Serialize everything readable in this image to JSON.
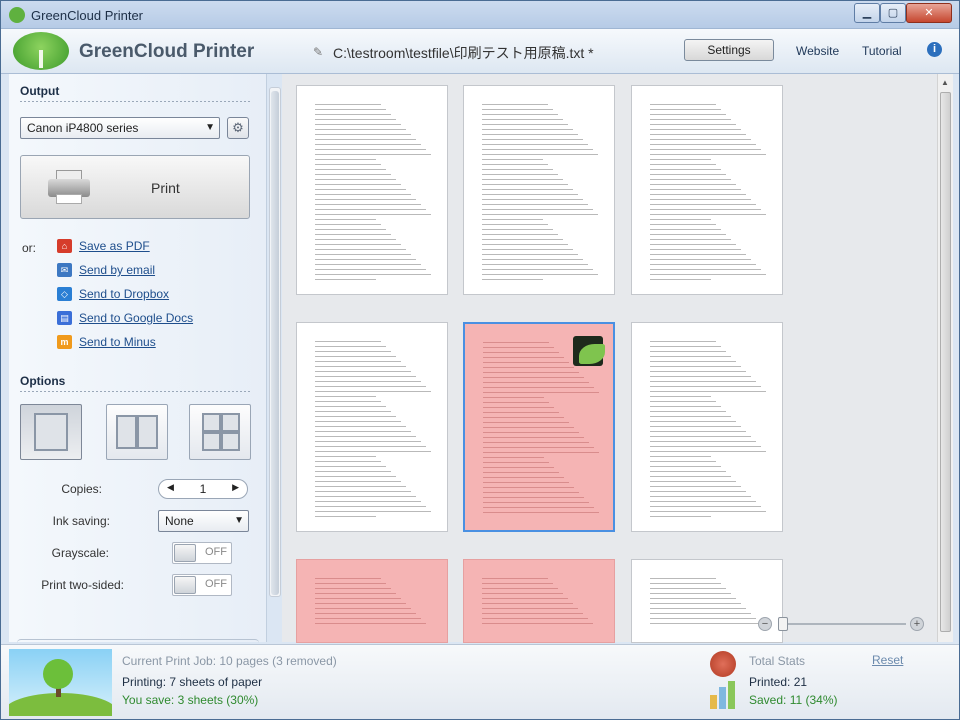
{
  "window": {
    "title": "GreenCloud Printer",
    "controls": {
      "minimize": "▁",
      "maximize": "▢",
      "close": "✕"
    }
  },
  "header": {
    "brand": "GreenCloud Printer",
    "file_path": "C:\\testroom\\testfile\\印刷テスト用原稿.txt *",
    "settings_label": "Settings",
    "website_label": "Website",
    "tutorial_label": "Tutorial",
    "info_icon": "i"
  },
  "sidebar": {
    "output_title": "Output",
    "printer_selected": "Canon iP4800 series",
    "print_label": "Print",
    "or_label": "or:",
    "share_items": [
      {
        "label": "Save as PDF",
        "icon": "pdf-icon",
        "color": "#d63c2b"
      },
      {
        "label": "Send by email",
        "icon": "email-icon",
        "color": "#3d78c2"
      },
      {
        "label": "Send to Dropbox",
        "icon": "dropbox-icon",
        "color": "#2a7fd4"
      },
      {
        "label": "Send to Google Docs",
        "icon": "google-docs-icon",
        "color": "#3b6fd8"
      },
      {
        "label": "Send to Minus",
        "icon": "minus-icon",
        "color": "#f09a1c"
      }
    ],
    "options_title": "Options",
    "copies_label": "Copies:",
    "copies_value": "1",
    "ink_saving_label": "Ink saving:",
    "ink_saving_value": "None",
    "grayscale_label": "Grayscale:",
    "grayscale_state": "OFF",
    "two_sided_label": "Print two-sided:",
    "two_sided_state": "OFF"
  },
  "footer": {
    "current_job": "Current Print Job: 10 pages (3 removed)",
    "printing": "Printing: 7 sheets of paper",
    "you_save": "You save: 3 sheets (30%)",
    "total_stats": "Total Stats",
    "reset": "Reset",
    "printed": "Printed: 21",
    "saved": "Saved: 11 (34%)"
  },
  "colors": {
    "accent": "#3c9a2a",
    "saved_page": "#f5b4b4",
    "selection": "#4a90e2"
  }
}
